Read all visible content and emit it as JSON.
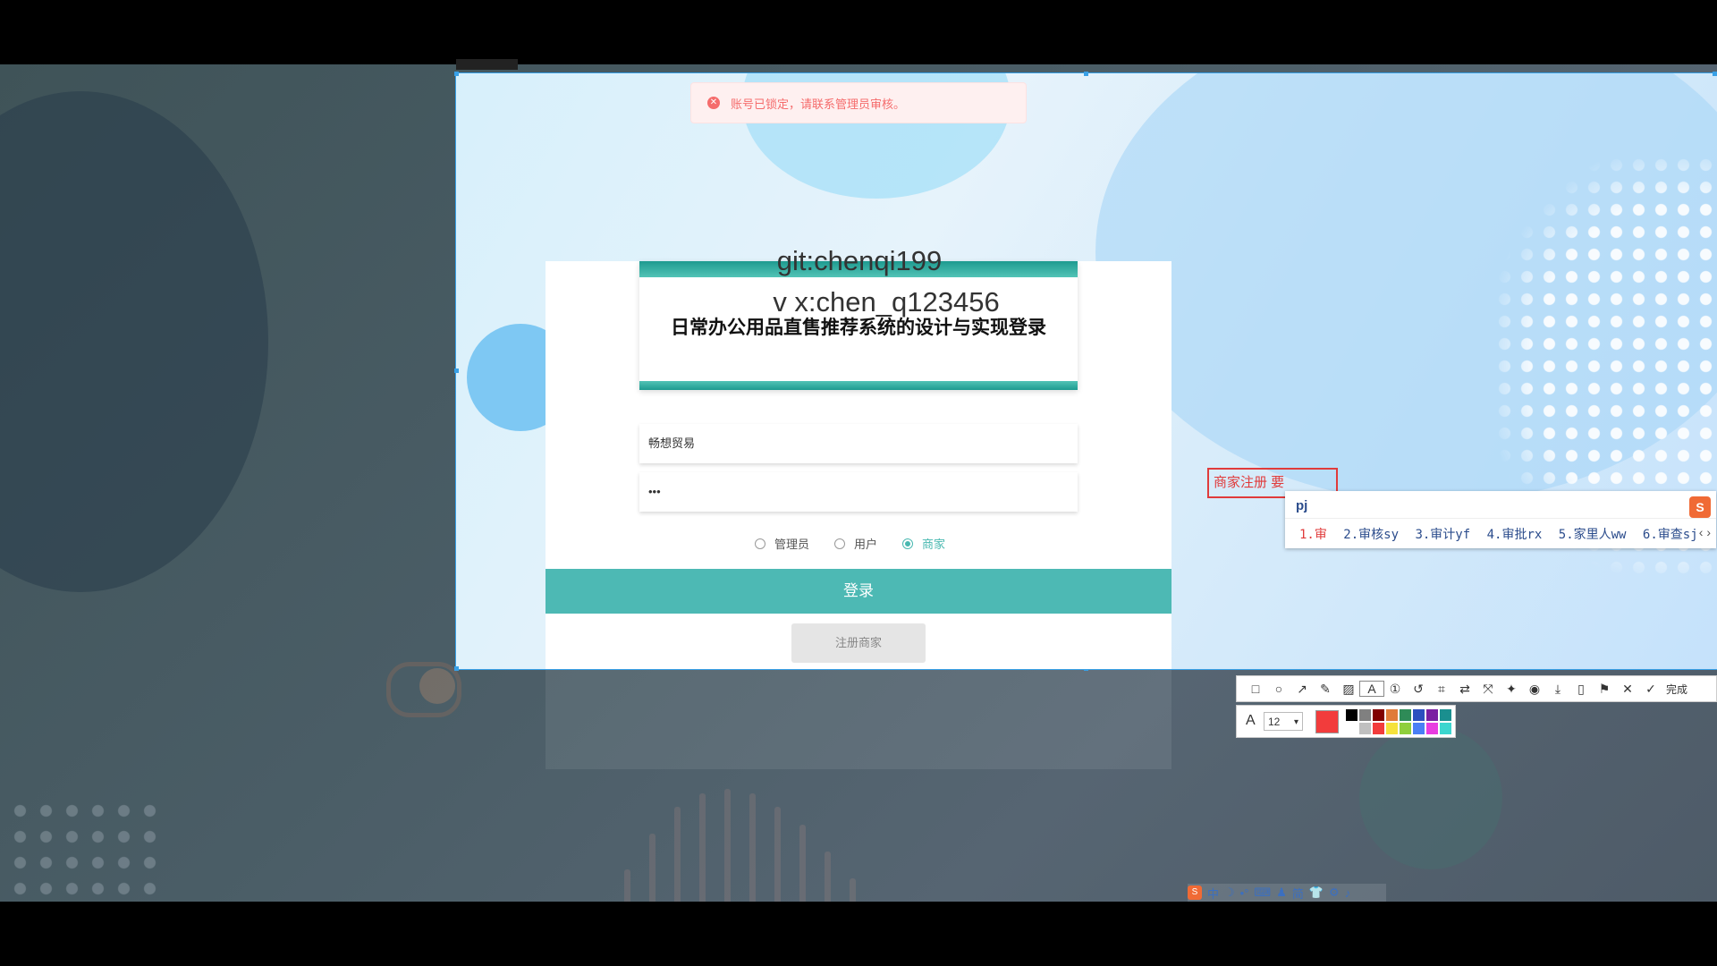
{
  "capture": {
    "size_label": ""
  },
  "toast": {
    "message": "账号已锁定，请联系管理员审核。",
    "icon": "error-circle-icon",
    "color": "#f56c6c"
  },
  "watermark": {
    "line1": "git:chenqi199",
    "line2": "v x:chen_q123456"
  },
  "login": {
    "title": "日常办公用品直售推荐系统的设计与实现登录",
    "username_value": "畅想贸易",
    "password_value": "•••",
    "roles": [
      {
        "label": "管理员",
        "selected": false
      },
      {
        "label": "用户",
        "selected": false
      },
      {
        "label": "商家",
        "selected": true
      }
    ],
    "login_button": "登录",
    "register_button": "注册商家",
    "accent_color": "#4db9b4"
  },
  "annotation": {
    "text": "商家注册 要"
  },
  "ime": {
    "input": "pj",
    "candidates": [
      "1.审",
      "2.审核sy",
      "3.审计yf",
      "4.审批rx",
      "5.家里人ww",
      "6.审查sj"
    ],
    "nav": "‹ ›"
  },
  "toolbar": {
    "tools": [
      "rectangle-icon",
      "ellipse-icon",
      "arrow-icon",
      "pen-icon",
      "mosaic-icon",
      "text-icon",
      "number-icon",
      "undo-icon",
      "ocr-icon",
      "translate-icon",
      "long-capture-icon",
      "pin-icon",
      "record-icon",
      "download-icon",
      "phone-icon",
      "bookmark-icon",
      "close-icon"
    ],
    "done_label": "完成",
    "font_size": "12",
    "current_color": "#f23c3c",
    "palette": [
      "#000000",
      "#808080",
      "#800000",
      "#e07b39",
      "#2e8b57",
      "#2b4fbf",
      "#7a1fa2",
      "#1a8f8f",
      "#ffffff",
      "#c0c0c0",
      "#f23c3c",
      "#f5e23c",
      "#8fcf3c",
      "#4a7ff5",
      "#e83ce0",
      "#3cd6cf"
    ]
  },
  "tray": {
    "items": [
      "中",
      "☽",
      "•°",
      "⌨",
      "♟",
      "简",
      "👕",
      "⚙",
      "♪"
    ]
  }
}
